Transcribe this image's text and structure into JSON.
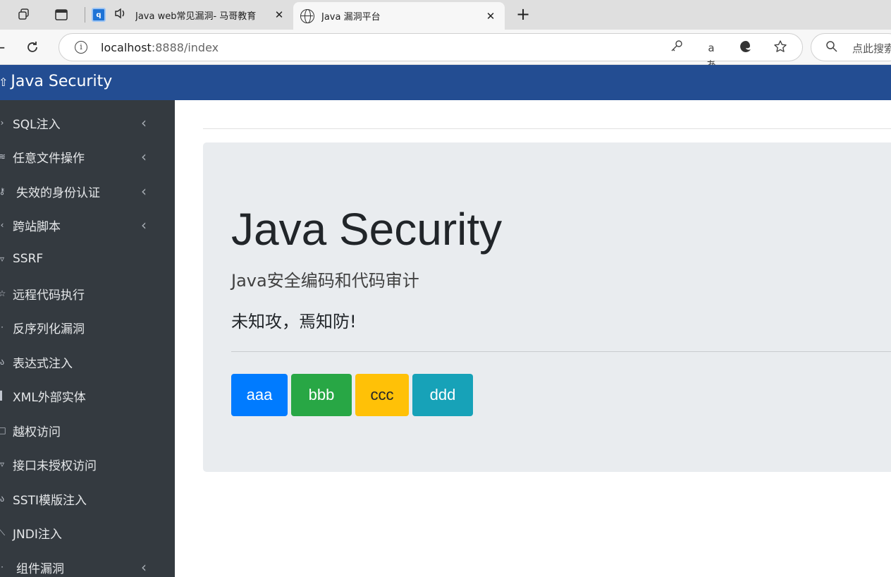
{
  "browser": {
    "tabs": [
      {
        "title": "Java web常见漏洞- 马哥教育",
        "favicon": "app-favicon",
        "audio": true,
        "active": false
      },
      {
        "title": "Java 漏洞平台",
        "favicon": "globe-icon",
        "audio": false,
        "active": true
      }
    ],
    "close_glyph": "✕",
    "new_tab_glyph": "+",
    "url_host": "localhost",
    "url_rest": ":8888/index",
    "search_placeholder": "点此搜索"
  },
  "app": {
    "brand": "Java Security",
    "header_color": "#234d92",
    "sidebar_color": "#343a40"
  },
  "sidebar": {
    "items": [
      {
        "label": "SQL注入",
        "icon": "chevron-right-icon",
        "glyph": "›",
        "has_submenu": true
      },
      {
        "label": "任意文件操作",
        "icon": "file-icon",
        "glyph": "≋",
        "has_submenu": true
      },
      {
        "label": "失效的身份认证",
        "icon": "key-icon",
        "glyph": "⚷",
        "has_submenu": true
      },
      {
        "label": "跨站脚本",
        "icon": "code-icon",
        "glyph": "‹",
        "has_submenu": true
      },
      {
        "label": "SSRF",
        "icon": "shield-icon",
        "glyph": "▿",
        "has_submenu": false
      },
      {
        "label": "远程代码执行",
        "icon": "star-icon",
        "glyph": "☆",
        "has_submenu": false
      },
      {
        "label": "反序列化漏洞",
        "icon": "bars-icon",
        "glyph": "·",
        "has_submenu": false
      },
      {
        "label": "表达式注入",
        "icon": "flask-icon",
        "glyph": "ა",
        "has_submenu": false
      },
      {
        "label": "XML外部实体",
        "icon": "document-icon",
        "glyph": "▌",
        "has_submenu": false
      },
      {
        "label": "越权访问",
        "icon": "square-icon",
        "glyph": "□",
        "has_submenu": false
      },
      {
        "label": "接口未授权访问",
        "icon": "shield-outline-icon",
        "glyph": "▿",
        "has_submenu": false
      },
      {
        "label": "SSTI模版注入",
        "icon": "template-icon",
        "glyph": "ა",
        "has_submenu": false
      },
      {
        "label": "JNDI注入",
        "icon": "plug-icon",
        "glyph": "⟍",
        "has_submenu": false
      },
      {
        "label": "组件漏洞",
        "icon": "component-icon",
        "glyph": "·",
        "has_submenu": true
      }
    ],
    "submenu_glyph": "‹"
  },
  "main": {
    "title": "Java Security",
    "subtitle": "Java安全编码和代码审计",
    "motto": "未知攻，焉知防!",
    "buttons": [
      {
        "label": "aaa",
        "color": "#007bff"
      },
      {
        "label": "bbb",
        "color": "#28a745"
      },
      {
        "label": "ccc",
        "color": "#ffc107"
      },
      {
        "label": "ddd",
        "color": "#17a2b8"
      }
    ]
  }
}
